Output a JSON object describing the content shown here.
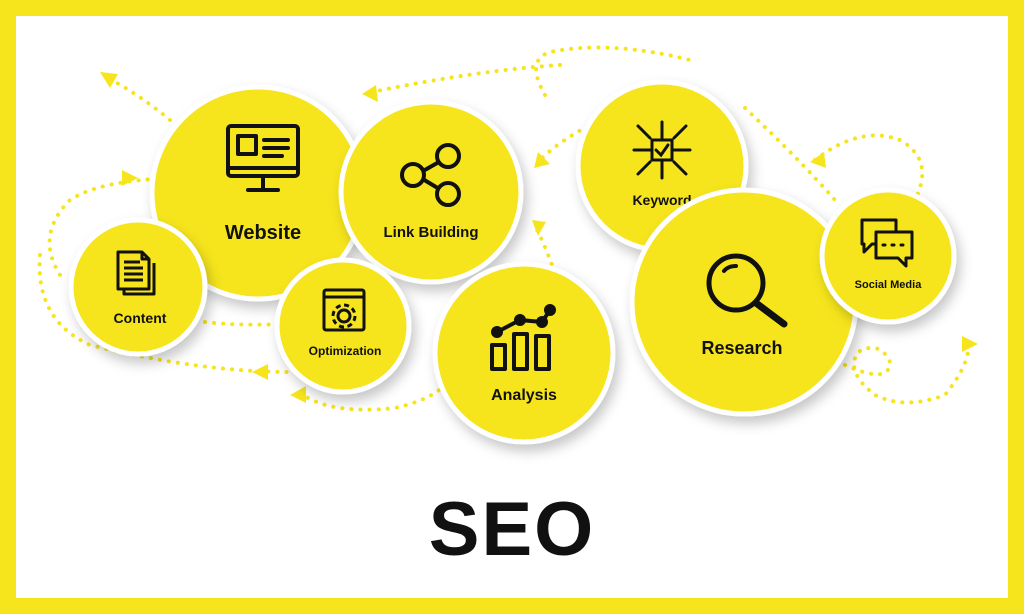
{
  "title": "SEO",
  "colors": {
    "accent": "#f6e51c",
    "ink": "#111111",
    "background": "#ffffff"
  },
  "nodes": [
    {
      "id": "website",
      "label": "Website",
      "icon": "monitor-icon"
    },
    {
      "id": "link_building",
      "label": "Link Building",
      "icon": "share-icon"
    },
    {
      "id": "content",
      "label": "Content",
      "icon": "document-icon"
    },
    {
      "id": "optimization",
      "label": "Optimization",
      "icon": "gear-window-icon"
    },
    {
      "id": "analysis",
      "label": "Analysis",
      "icon": "bar-chart-icon"
    },
    {
      "id": "keyword",
      "label": "Keyword",
      "icon": "target-arrows-icon"
    },
    {
      "id": "research",
      "label": "Research",
      "icon": "magnifier-icon"
    },
    {
      "id": "social_media",
      "label": "Social Media",
      "icon": "chat-bubbles-icon"
    }
  ]
}
